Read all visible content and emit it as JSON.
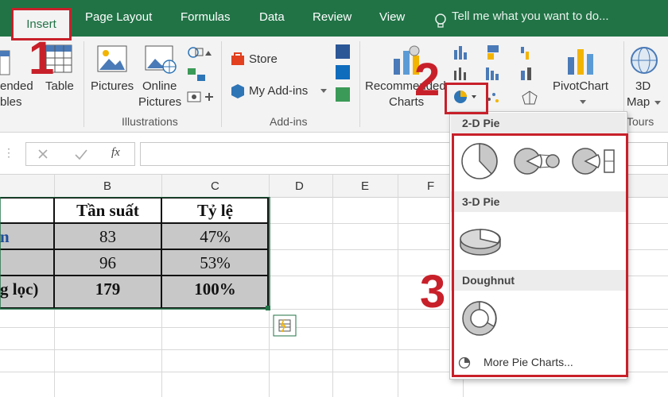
{
  "tabs": {
    "insert": "Insert",
    "page_layout": "Page Layout",
    "formulas": "Formulas",
    "data": "Data",
    "review": "Review",
    "view": "View"
  },
  "tell_me": "Tell me what you want to do...",
  "ribbon": {
    "recommended_pivot_line1": "ended",
    "recommended_pivot_line2": "bles",
    "table": "Table",
    "pictures": "Pictures",
    "online_pictures_line1": "Online",
    "online_pictures_line2": "Pictures",
    "store": "Store",
    "my_addins": "My Add-ins",
    "recommended_charts_line1": "Recommended",
    "recommended_charts_line2": "Charts",
    "pivotchart": "PivotChart",
    "map_3d_line1": "3D",
    "map_3d_line2": "Map",
    "groups": {
      "illustrations": "Illustrations",
      "addins": "Add-ins",
      "tours": "Tours"
    }
  },
  "formula": {
    "fx": "fx"
  },
  "columns": [
    "B",
    "C",
    "D",
    "E",
    "F"
  ],
  "table": {
    "header": [
      "Tần suất",
      "Tỷ lệ"
    ],
    "rows": [
      {
        "label": "n",
        "freq": "83",
        "pct": "47%"
      },
      {
        "label": "",
        "freq": "96",
        "pct": "53%"
      },
      {
        "label": "g lọc)",
        "freq": "179",
        "pct": "100%"
      }
    ]
  },
  "dropdown": {
    "pie2d": "2-D Pie",
    "pie3d": "3-D Pie",
    "doughnut": "Doughnut",
    "more": "More Pie Charts..."
  },
  "annotations": {
    "n1": "1",
    "n2": "2",
    "n3": "3"
  },
  "colors": {
    "excel_green": "#217346",
    "annotation_red": "#c8202a"
  }
}
